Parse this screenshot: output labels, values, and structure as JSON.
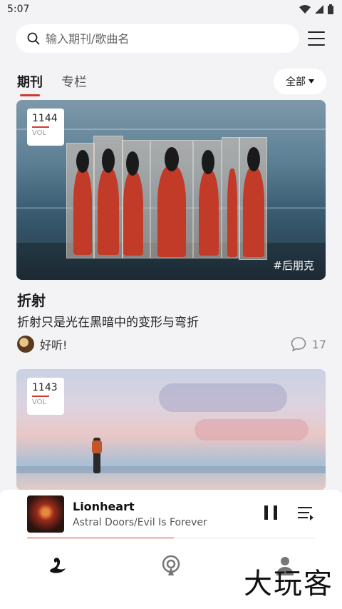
{
  "status_bar": {
    "time": "5:07"
  },
  "search": {
    "placeholder": "输入期刊/歌曲名"
  },
  "tabs": [
    {
      "label": "期刊",
      "active": true
    },
    {
      "label": "专栏",
      "active": false
    }
  ],
  "filter": {
    "label": "全部"
  },
  "cards": [
    {
      "vol_number": "1144",
      "vol_label": "VOL",
      "hashtag": "#后朋克",
      "title": "折射",
      "subtitle": "折射只是光在黑暗中的变形与弯折",
      "author": "好听!",
      "comment_count": "17"
    },
    {
      "vol_number": "1143",
      "vol_label": "VOL"
    }
  ],
  "player": {
    "song": "Lionheart",
    "artist": "Astral Doors/Evil Is Forever",
    "progress": 0.51
  },
  "bottom_nav": [
    {
      "icon": "swan-icon",
      "active": true
    },
    {
      "icon": "podcast-icon",
      "active": false
    },
    {
      "icon": "profile-icon",
      "active": false
    }
  ],
  "watermark": "大玩客",
  "colors": {
    "accent": "#d33a31",
    "background": "#f3f3f6"
  }
}
